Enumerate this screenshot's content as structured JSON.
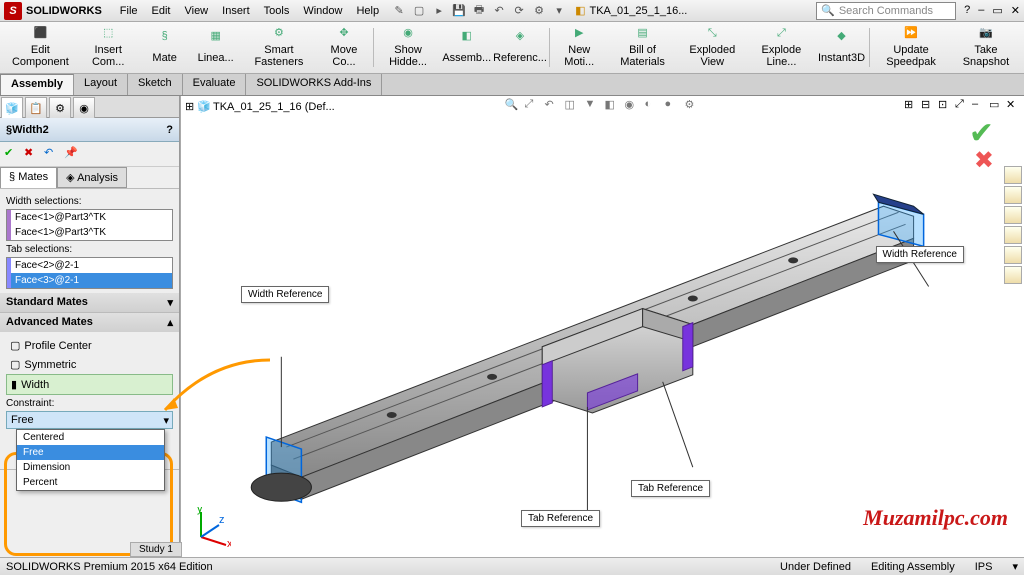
{
  "app": {
    "name": "SOLIDWORKS",
    "doc": "TKA_01_25_1_16..."
  },
  "menu": {
    "file": "File",
    "edit": "Edit",
    "view": "View",
    "insert": "Insert",
    "tools": "Tools",
    "window": "Window",
    "help": "Help"
  },
  "search": {
    "placeholder": "Search Commands"
  },
  "ribbon": {
    "edit": "Edit Component",
    "insert": "Insert Com...",
    "mate": "Mate",
    "linear": "Linea...",
    "fasteners": "Smart Fasteners",
    "move": "Move Co...",
    "show": "Show Hidde...",
    "assem": "Assemb...",
    "ref": "Referenc...",
    "newmot": "New Moti...",
    "bom": "Bill of Materials",
    "explview": "Exploded View",
    "explline": "Explode Line...",
    "instant": "Instant3D",
    "speed": "Update Speedpak",
    "snap": "Take Snapshot"
  },
  "tabs": {
    "assembly": "Assembly",
    "layout": "Layout",
    "sketch": "Sketch",
    "evaluate": "Evaluate",
    "addins": "SOLIDWORKS Add-Ins"
  },
  "tree": {
    "root": "TKA_01_25_1_16  (Def..."
  },
  "panel": {
    "title": "Width2",
    "matesTab": "Mates",
    "analysisTab": "Analysis",
    "widthSel": "Width selections:",
    "widthItems": [
      "Face<1>@Part3^TK",
      "Face<1>@Part3^TK"
    ],
    "tabSel": "Tab selections:",
    "tabItems": [
      "Face<2>@2-1",
      "Face<3>@2-1"
    ],
    "stdMates": "Standard Mates",
    "advMates": "Advanced Mates",
    "profileCenter": "Profile Center",
    "symmetric": "Symmetric",
    "width": "Width",
    "constraint": "Constraint:",
    "constraintVal": "Free",
    "options": [
      "Centered",
      "Free",
      "Dimension",
      "Percent"
    ]
  },
  "callouts": {
    "widthRef": "Width Reference",
    "tabRef": "Tab Reference"
  },
  "status": {
    "bottomTab": "  Study 1",
    "text": "SOLIDWORKS Premium 2015 x64 Edition",
    "underDefined": "Under Defined",
    "editing": "Editing Assembly",
    "units": "IPS"
  },
  "watermark": "Muzamilpc.com"
}
